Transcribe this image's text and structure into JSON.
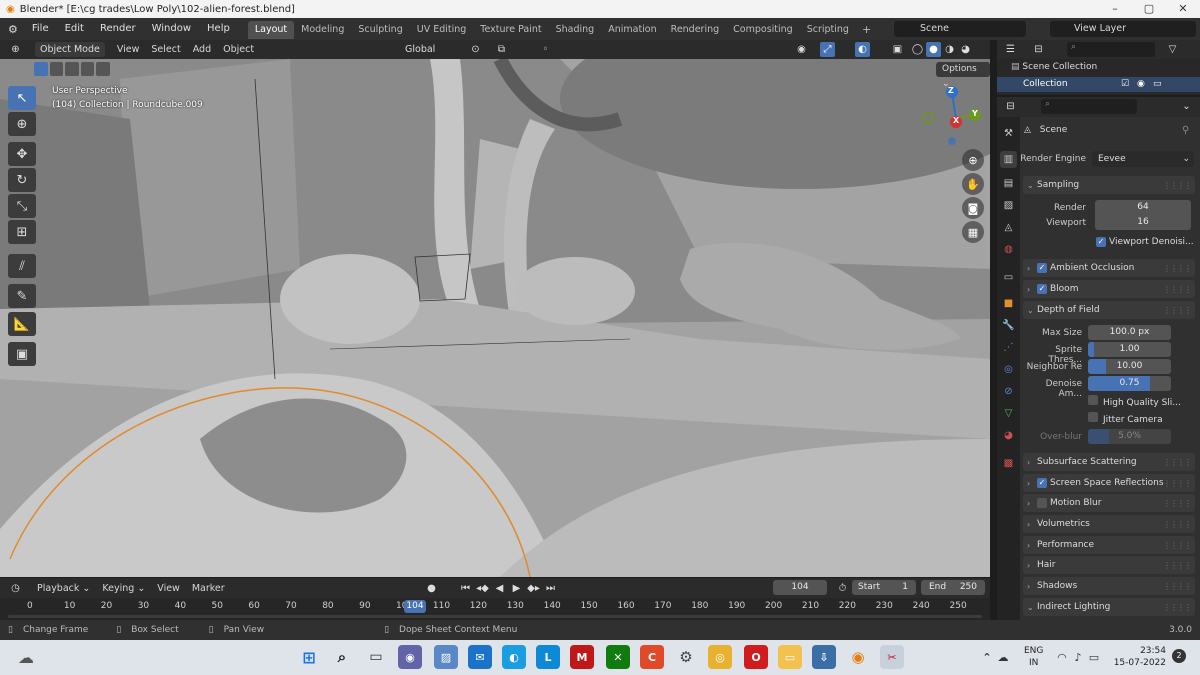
{
  "window": {
    "title": "Blender* [E:\\cg trades\\Low Poly\\102-alien-forest.blend]"
  },
  "menu": [
    "File",
    "Edit",
    "Render",
    "Window",
    "Help"
  ],
  "workspaces": [
    "Layout",
    "Modeling",
    "Sculpting",
    "UV Editing",
    "Texture Paint",
    "Shading",
    "Animation",
    "Rendering",
    "Compositing",
    "Scripting"
  ],
  "scene_name": "Scene",
  "view_layer": "View Layer",
  "viewport": {
    "mode": "Object Mode",
    "menus": [
      "View",
      "Select",
      "Add",
      "Object"
    ],
    "transform": "Global",
    "options": "Options",
    "info_line1": "User Perspective",
    "info_line2": "(104) Collection | Roundcube.009",
    "gizmo": {
      "x": "X",
      "y": "Y",
      "z": "Z"
    }
  },
  "outliner": {
    "scene_collection": "Scene Collection",
    "collection": "Collection"
  },
  "properties": {
    "scene": "Scene",
    "render_engine_label": "Render Engine",
    "render_engine": "Eevee",
    "sampling": "Sampling",
    "render_label": "Render",
    "render_val": "64",
    "viewport_label": "Viewport",
    "viewport_val": "16",
    "viewport_denoise": "Viewport Denoisi...",
    "ambient_occlusion": "Ambient Occlusion",
    "bloom": "Bloom",
    "depth_of_field": "Depth of Field",
    "max_size_label": "Max Size",
    "max_size": "100.0 px",
    "sprite_label": "Sprite Thres...",
    "sprite": "1.00",
    "neighbor_label": "Neighbor Re",
    "neighbor": "10.00",
    "denoise_label": "Denoise Am...",
    "denoise": "0.75",
    "hq_slices": "High Quality Sli...",
    "jitter": "Jitter Camera",
    "overblur_label": "Over-blur",
    "overblur": "5.0%",
    "subsurface": "Subsurface Scattering",
    "ssr": "Screen Space Reflections",
    "motion_blur": "Motion Blur",
    "volumetrics": "Volumetrics",
    "performance": "Performance",
    "hair": "Hair",
    "shadows": "Shadows",
    "indirect": "Indirect Lighting"
  },
  "timeline": {
    "playback": "Playback",
    "keying": "Keying",
    "view": "View",
    "marker": "Marker",
    "frame": "104",
    "start_label": "Start",
    "start": "1",
    "end_label": "End",
    "end": "250",
    "ticks": [
      "0",
      "10",
      "20",
      "30",
      "40",
      "50",
      "60",
      "70",
      "80",
      "90",
      "100",
      "110",
      "120",
      "130",
      "140",
      "150",
      "160",
      "170",
      "180",
      "190",
      "200",
      "210",
      "220",
      "230",
      "240",
      "250"
    ],
    "current": "104"
  },
  "status": {
    "change_frame": "Change Frame",
    "box_select": "Box Select",
    "pan_view": "Pan View",
    "context_menu": "Dope Sheet Context Menu",
    "version": "3.0.0"
  },
  "tray": {
    "lang1": "ENG",
    "lang2": "IN",
    "time": "23:54",
    "date": "15-07-2022",
    "notif": "2"
  },
  "colors": {
    "accent": "#4772b3",
    "selection": "#e08a2e"
  }
}
